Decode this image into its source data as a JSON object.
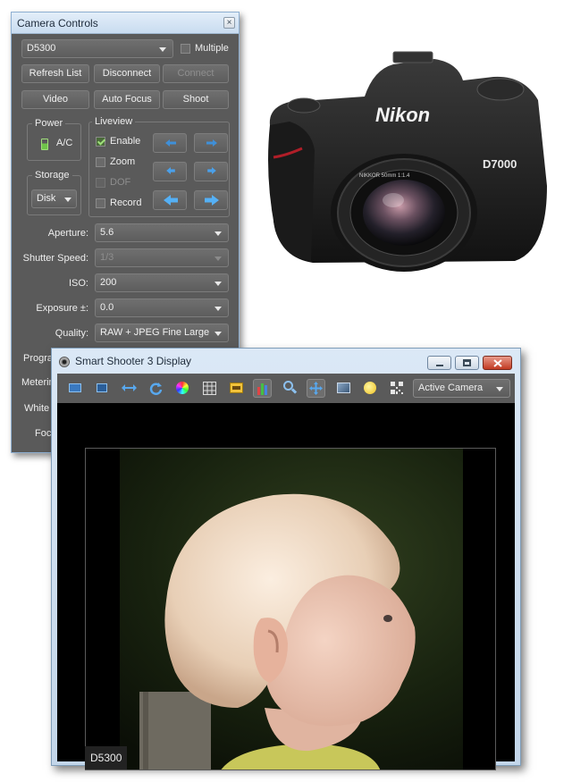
{
  "camera_controls": {
    "title": "Camera Controls",
    "close_glyph": "×",
    "camera_select": "D5300",
    "multiple_label": "Multiple",
    "buttons": {
      "refresh": "Refresh List",
      "disconnect": "Disconnect",
      "connect": "Connect",
      "video": "Video",
      "auto_focus": "Auto Focus",
      "shoot": "Shoot"
    },
    "power": {
      "title": "Power",
      "value": "A/C"
    },
    "storage": {
      "title": "Storage",
      "value": "Disk"
    },
    "liveview": {
      "title": "Liveview",
      "enable": "Enable",
      "zoom": "Zoom",
      "dof": "DOF",
      "record": "Record"
    },
    "settings": {
      "aperture_label": "Aperture:",
      "aperture_value": "5.6",
      "shutter_label": "Shutter Speed:",
      "shutter_value": "1/3",
      "iso_label": "ISO:",
      "iso_value": "200",
      "exposure_label": "Exposure ±:",
      "exposure_value": "0.0",
      "quality_label": "Quality:",
      "quality_value": "RAW + JPEG Fine Large"
    },
    "partial_labels": {
      "program": "Progra",
      "metering": "Meterin",
      "white": "White",
      "focus": "Foc"
    }
  },
  "product": {
    "brand": "Nikon",
    "model": "D7000"
  },
  "display": {
    "title": "Smart Shooter 3 Display",
    "camera_select": "Active Camera",
    "camera_tag": "D5300",
    "toolbar_icons": [
      "grid-view-icon",
      "single-view-icon",
      "fit-width-icon",
      "refresh-icon",
      "color-wheel-icon",
      "grid-overlay-icon",
      "focus-point-icon",
      "histogram-icon",
      "zoom-icon",
      "pan-icon",
      "image-compare-icon",
      "light-icon",
      "qr-code-icon"
    ]
  },
  "colors": {
    "panel": "#5a5a5a",
    "title_bar": "#c9dcf0",
    "accent": "#3f8fd8",
    "close_red": "#c23a22"
  }
}
